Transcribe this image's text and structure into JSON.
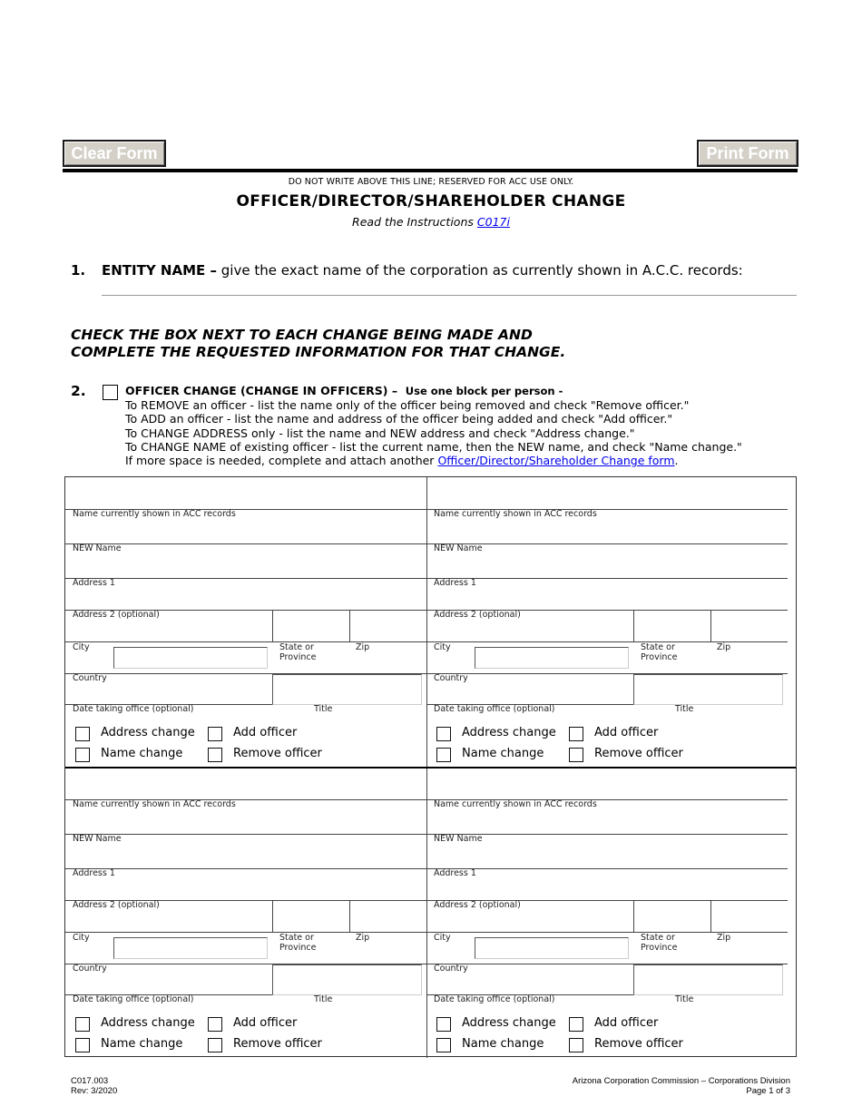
{
  "buttons": {
    "clear_form": "Clear Form",
    "print_form": "Print Form"
  },
  "header": {
    "reserved_notice": "DO NOT WRITE ABOVE THIS LINE; RESERVED FOR ACC USE ONLY.",
    "title": "OFFICER/DIRECTOR/SHAREHOLDER CHANGE",
    "instructions_prefix": "Read the Instructions",
    "instructions_link": "C017i"
  },
  "section1": {
    "number": "1.",
    "label": "ENTITY NAME –",
    "text": "give the exact name of the corporation as currently shown in A.C.C. records:",
    "entity_name_value": ""
  },
  "check_heading": {
    "line1": "CHECK THE BOX NEXT TO EACH CHANGE BEING MADE AND",
    "line2": "COMPLETE THE REQUESTED INFORMATION FOR THAT CHANGE."
  },
  "section2": {
    "number": "2.",
    "title": "OFFICER CHANGE (CHANGE IN OFFICERS) –",
    "subtitle": "Use one block per person -",
    "lines": [
      "To REMOVE an officer - list the name only of the officer being removed and check \"Remove officer.\"",
      "To ADD  an officer - list the name and address of the officer being added and check \"Add officer.\"",
      "To CHANGE ADDRESS only - list the name and NEW address and check \"Address change.\"",
      "To CHANGE NAME of existing officer - list the current name, then the NEW name, and check \"Name change.\""
    ],
    "more_space_prefix": "If more space is needed, complete and attach another",
    "more_space_link": "Officer/Director/Shareholder Change form",
    "more_space_suffix": "."
  },
  "officer_block_labels": {
    "name_current": "Name currently shown in ACC records",
    "new_name": "NEW Name",
    "address1": "Address 1",
    "address2": "Address 2 (optional)",
    "city": "City",
    "state": "State or",
    "province": "Province",
    "zip": "Zip",
    "country": "Country",
    "date_taking_office": "Date taking office (optional)",
    "title": "Title",
    "address_change": "Address change",
    "add_officer": "Add officer",
    "name_change": "Name change",
    "remove_officer": "Remove officer"
  },
  "footer": {
    "form_code": "C017.003",
    "revision": "Rev: 3/2020",
    "agency": "Arizona Corporation Commission – Corporations Division",
    "page": "Page 1 of 3"
  }
}
